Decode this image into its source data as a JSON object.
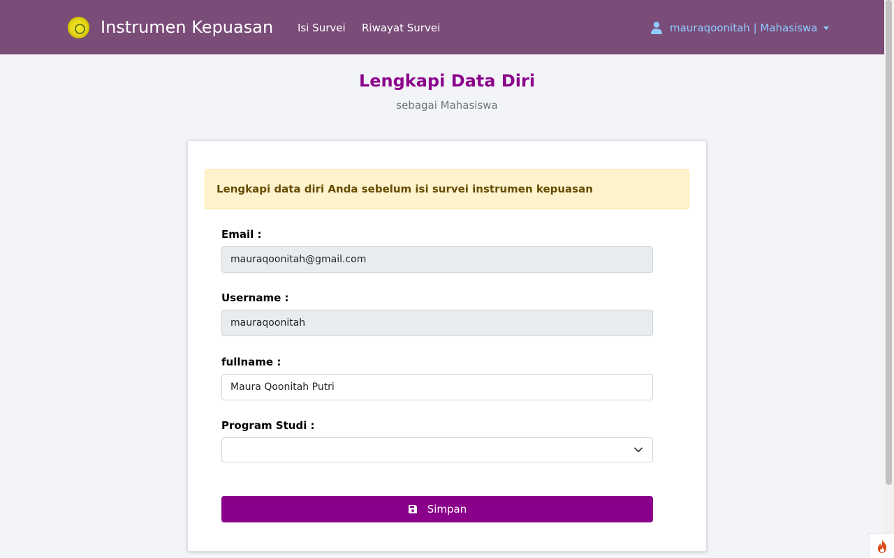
{
  "navbar": {
    "brand_title": "Instrumen Kepuasan",
    "links": [
      "Isi Survei",
      "Riwayat Survei"
    ],
    "user_label": "mauraqoonitah | Mahasiswa",
    "background_color": "#7a4c78"
  },
  "page": {
    "heading": "Lengkapi Data Diri",
    "subheading": "sebagai Mahasiswa",
    "heading_color": "#8b008b"
  },
  "form": {
    "alert_text": "Lengkapi data diri Anda sebelum isi survei instrumen kepuasan",
    "email": {
      "label": "Email :",
      "value": "mauraqoonitah@gmail.com"
    },
    "username": {
      "label": "Username :",
      "value": "mauraqoonitah"
    },
    "fullname": {
      "label": "fullname :",
      "value": "Maura Qoonitah Putri"
    },
    "program_studi": {
      "label": "Program Studi :",
      "value": ""
    },
    "save_label": "Simpan",
    "button_color": "#8b008b"
  },
  "icons": {
    "user": "user-icon",
    "caret": "caret-down-icon",
    "chevron": "chevron-down-icon",
    "save": "floppy-disk-icon",
    "flame": "flame-icon"
  }
}
